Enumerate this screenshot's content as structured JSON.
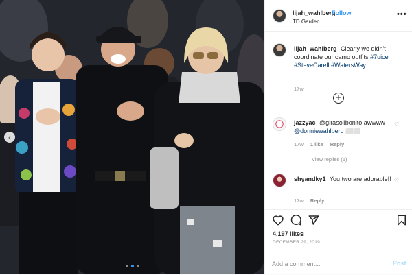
{
  "post": {
    "username": "lijah_wahlberg",
    "follow_label": "Follow",
    "separator": "•",
    "location": "TD Garden",
    "more_label": "•••",
    "caption": {
      "text": "Clearly we didn't coordinate our camo outfits",
      "tags": [
        "#7uice",
        "#SteveCarell",
        "#WatersWay"
      ],
      "time": "17w"
    },
    "load_more_label": "+",
    "comments": [
      {
        "username": "jazzyac",
        "text_prefix": "@girasollbonito awwww",
        "mention": "@donniewahlberg",
        "emoji": "⬜⬜",
        "time": "17w",
        "likes": "1 like",
        "reply": "Reply",
        "view_replies": "View replies (1)"
      },
      {
        "username": "shyandky1",
        "text": "You two are adorable!!",
        "time": "17w",
        "reply": "Reply"
      }
    ],
    "likes_count": "4,197 likes",
    "date": "DECEMBER 29, 2019",
    "add_comment_placeholder": "Add a comment...",
    "post_button": "Post"
  },
  "icons": {
    "prev": "chevron-left-icon",
    "heart": "heart-icon",
    "comment": "comment-icon",
    "share": "share-icon",
    "save": "bookmark-icon",
    "more": "more-options-icon"
  },
  "colors": {
    "link_blue": "#3897f0",
    "tag_blue": "#00376b",
    "muted": "#8e8e8e",
    "post_disabled": "#b2dffc"
  },
  "carousel": {
    "slide_count": 3,
    "active_slide": 2
  }
}
